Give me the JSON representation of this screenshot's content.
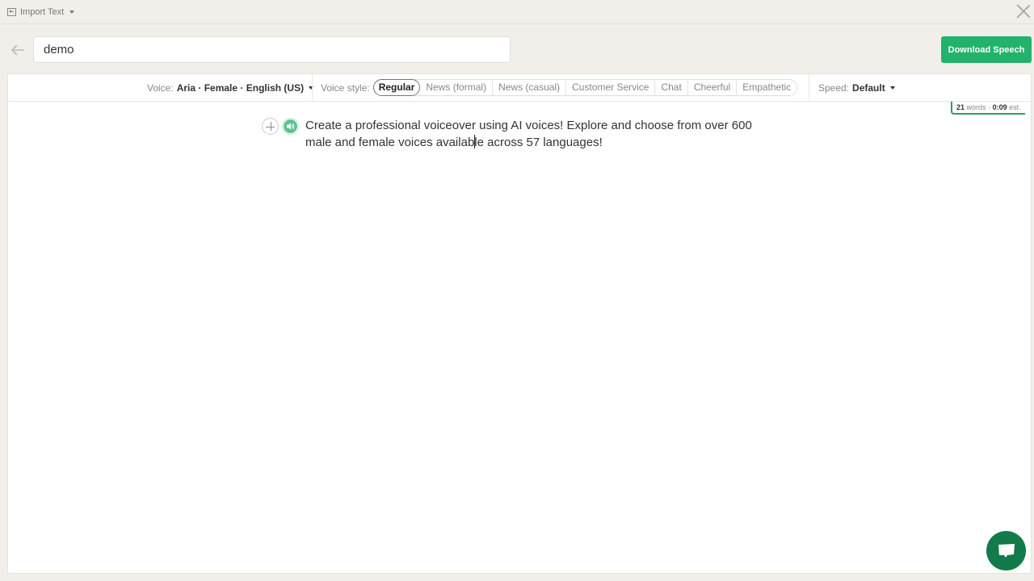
{
  "topbar": {
    "import_label": "Import Text",
    "import_icon": "import-icon",
    "close_icon": "close-icon"
  },
  "header": {
    "back_icon": "arrow-left-icon",
    "title_value": "demo",
    "download_label": "Download Speech"
  },
  "toolbar": {
    "voice_label": "Voice:",
    "voice_value": "Aria · Female · English (US)",
    "style_label": "Voice style:",
    "styles": [
      {
        "label": "Regular",
        "active": true
      },
      {
        "label": "News (formal)",
        "active": false
      },
      {
        "label": "News (casual)",
        "active": false
      },
      {
        "label": "Customer Service",
        "active": false
      },
      {
        "label": "Chat",
        "active": false
      },
      {
        "label": "Cheerful",
        "active": false
      },
      {
        "label": "Empathetic",
        "active": false
      }
    ],
    "speed_label": "Speed:",
    "speed_value": "Default"
  },
  "stats": {
    "words_count": "21",
    "words_label": "words",
    "separator": "·",
    "duration": "0:09",
    "duration_label": "est."
  },
  "editor": {
    "paragraph_before_cursor": "Create a professional voiceover using AI voices! Explore and choose from over 600 male and female voices availab",
    "paragraph_after_cursor": "le across 57 languages!"
  },
  "colors": {
    "accent": "#21b36b",
    "fab": "#137a4b",
    "background": "#f2efeb"
  }
}
